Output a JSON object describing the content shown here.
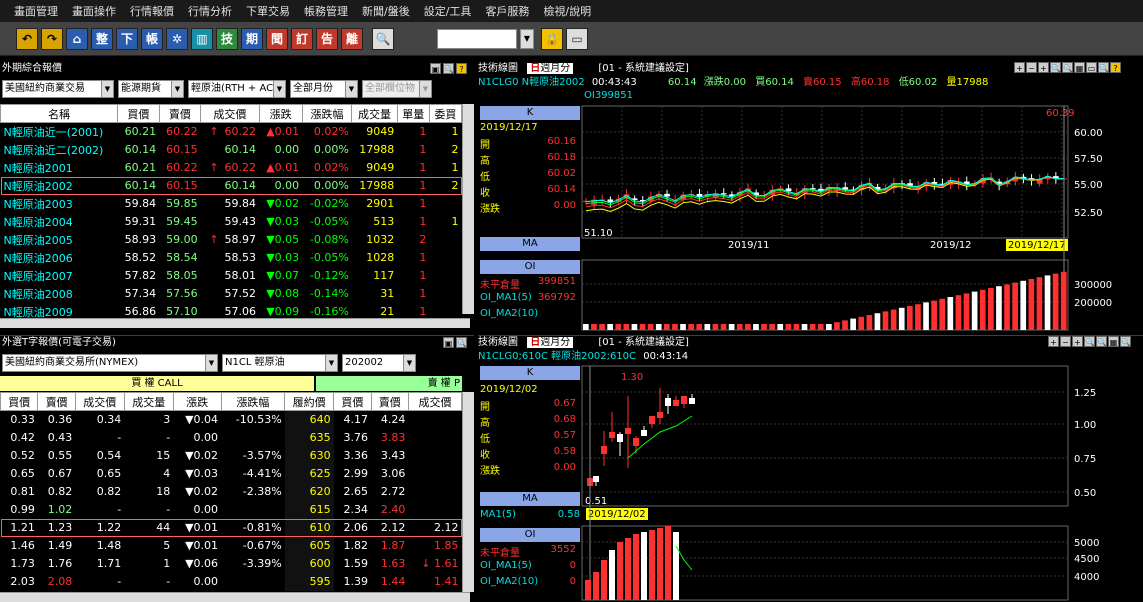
{
  "menu": [
    "畫面管理",
    "畫面操作",
    "行情報價",
    "行情分析",
    "下單交易",
    "帳務管理",
    "新聞/盤後",
    "設定/工具",
    "客戶服務",
    "檢視/說明"
  ],
  "toolbar": {
    "buttons": [
      "undo",
      "redo",
      "home",
      "整",
      "下",
      "帳",
      "gear",
      "chart",
      "技",
      "期",
      "聞",
      "訂",
      "告",
      "離",
      "search"
    ]
  },
  "futures": {
    "title": "外期綜合報價",
    "filters": [
      "美國紐約商業交易",
      "能源期貨",
      "輕原油(RTH + ACC",
      "全部月份",
      "全部欄位物"
    ],
    "headers": [
      "名稱",
      "買價",
      "賣價",
      "成交價",
      "漲跌",
      "漲跌幅",
      "成交量",
      "單量",
      "委買"
    ],
    "rows": [
      {
        "name": "N輕原油近一(2001)",
        "bid": "60.21",
        "ask": "60.22",
        "arrow": "↑",
        "last": "60.22",
        "chg": "▲0.01",
        "pct": "0.02%",
        "vol": "9049",
        "unit": "1",
        "x": "1",
        "c": "up"
      },
      {
        "name": "N輕原油近二(2002)",
        "bid": "60.14",
        "ask": "60.15",
        "arrow": "",
        "last": "60.14",
        "chg": "0.00",
        "pct": "0.00%",
        "vol": "17988",
        "unit": "1",
        "x": "2",
        "c": "wh"
      },
      {
        "name": "N輕原油2001",
        "bid": "60.21",
        "ask": "60.22",
        "arrow": "↑",
        "last": "60.22",
        "chg": "▲0.01",
        "pct": "0.02%",
        "vol": "9049",
        "unit": "1",
        "x": "1",
        "c": "up"
      },
      {
        "name": "N輕原油2002",
        "bid": "60.14",
        "ask": "60.15",
        "arrow": "",
        "last": "60.14",
        "chg": "0.00",
        "pct": "0.00%",
        "vol": "17988",
        "unit": "1",
        "x": "2",
        "c": "wh"
      },
      {
        "name": "N輕原油2003",
        "bid": "59.84",
        "ask": "59.85",
        "arrow": "",
        "last": "59.84",
        "chg": "▼0.02",
        "pct": "-0.02%",
        "vol": "2901",
        "unit": "1",
        "x": "",
        "c": "dn"
      },
      {
        "name": "N輕原油2004",
        "bid": "59.31",
        "ask": "59.45",
        "arrow": "",
        "last": "59.43",
        "chg": "▼0.03",
        "pct": "-0.05%",
        "vol": "513",
        "unit": "1",
        "x": "1",
        "c": "dn"
      },
      {
        "name": "N輕原油2005",
        "bid": "58.93",
        "ask": "59.00",
        "arrow": "↑",
        "last": "58.97",
        "chg": "▼0.05",
        "pct": "-0.08%",
        "vol": "1032",
        "unit": "2",
        "x": "",
        "c": "dn"
      },
      {
        "name": "N輕原油2006",
        "bid": "58.52",
        "ask": "58.54",
        "arrow": "",
        "last": "58.53",
        "chg": "▼0.03",
        "pct": "-0.05%",
        "vol": "1028",
        "unit": "1",
        "x": "",
        "c": "dn"
      },
      {
        "name": "N輕原油2007",
        "bid": "57.82",
        "ask": "58.05",
        "arrow": "",
        "last": "58.01",
        "chg": "▼0.07",
        "pct": "-0.12%",
        "vol": "117",
        "unit": "1",
        "x": "",
        "c": "dn"
      },
      {
        "name": "N輕原油2008",
        "bid": "57.34",
        "ask": "57.56",
        "arrow": "",
        "last": "57.52",
        "chg": "▼0.08",
        "pct": "-0.14%",
        "vol": "31",
        "unit": "1",
        "x": "",
        "c": "dn"
      },
      {
        "name": "N輕原油2009",
        "bid": "56.86",
        "ask": "57.10",
        "arrow": "",
        "last": "57.06",
        "chg": "▼0.09",
        "pct": "-0.16%",
        "vol": "21",
        "unit": "1",
        "x": "",
        "c": "dn"
      }
    ]
  },
  "options": {
    "title": "外選T字報價(可電子交易)",
    "exchange": "美國紐約商業交易所(NYMEX)",
    "product": "N1CL 輕原油",
    "month": "202002",
    "call_label": "買 權 CALL",
    "put_label": "賣 權 P",
    "headers": [
      "買價",
      "賣價",
      "成交價",
      "成交量",
      "漲跌",
      "漲跌幅",
      "履約價",
      "買價",
      "賣價",
      "成交價"
    ],
    "rows": [
      {
        "cb": "0.33",
        "ca": "0.36",
        "cl": "0.34",
        "cv": "3",
        "ch": "▼0.04",
        "cp": "-10.53%",
        "k": "640",
        "pb": "4.17",
        "pa": "4.24",
        "pl": "",
        "pc": "wh"
      },
      {
        "cb": "0.42",
        "ca": "0.43",
        "cl": "-",
        "cv": "-",
        "ch": "0.00",
        "cp": "",
        "k": "635",
        "pb": "3.76",
        "pa": "3.83",
        "pl": "",
        "pc": "up"
      },
      {
        "cb": "0.52",
        "ca": "0.55",
        "cl": "0.54",
        "cv": "15",
        "ch": "▼0.02",
        "cp": "-3.57%",
        "k": "630",
        "pb": "3.36",
        "pa": "3.43",
        "pl": "",
        "pc": "wh"
      },
      {
        "cb": "0.65",
        "ca": "0.67",
        "cl": "0.65",
        "cv": "4",
        "ch": "▼0.03",
        "cp": "-4.41%",
        "k": "625",
        "pb": "2.99",
        "pa": "3.06",
        "pl": "",
        "pc": "wh"
      },
      {
        "cb": "0.81",
        "ca": "0.82",
        "cl": "0.82",
        "cv": "18",
        "ch": "▼0.02",
        "cp": "-2.38%",
        "k": "620",
        "pb": "2.65",
        "pa": "2.72",
        "pl": "",
        "pc": "wh"
      },
      {
        "cb": "0.99",
        "ca": "1.02",
        "cl": "-",
        "cv": "-",
        "ch": "0.00",
        "cp": "",
        "k": "615",
        "pb": "2.34",
        "pa": "2.40",
        "pl": "",
        "pc": "up"
      },
      {
        "cb": "1.21",
        "ca": "1.23",
        "cl": "1.22",
        "cv": "44",
        "ch": "▼0.01",
        "cp": "-0.81%",
        "k": "610",
        "pb": "2.06",
        "pa": "2.12",
        "pl": "2.12",
        "pc": "wh"
      },
      {
        "cb": "1.46",
        "ca": "1.49",
        "cl": "1.48",
        "cv": "5",
        "ch": "▼0.01",
        "cp": "-0.67%",
        "k": "605",
        "pb": "1.82",
        "pa": "1.87",
        "pl": "1.85",
        "pc": "up"
      },
      {
        "cb": "1.73",
        "ca": "1.76",
        "cl": "1.71",
        "cv": "1",
        "ch": "▼0.06",
        "cp": "-3.39%",
        "k": "600",
        "pb": "1.59",
        "pa": "1.63",
        "pl": "↓ 1.61",
        "pc": "up"
      },
      {
        "cb": "2.03",
        "ca": "2.08",
        "cl": "-",
        "cv": "-",
        "ch": "0.00",
        "cp": "",
        "k": "595",
        "pb": "1.39",
        "pa": "1.44",
        "pl": "1.41",
        "pc": "up"
      }
    ]
  },
  "chart1": {
    "title": "技術線圖",
    "period_tabs": [
      "日",
      "週",
      "月",
      "分"
    ],
    "setting": "[01 - 系統建議設定]",
    "symbol": "N1CLG0 N輕原油2002",
    "time": "00:43:43",
    "last": "60.14",
    "change": "漲跌0.00",
    "bid": "買60.14",
    "ask": "賣60.15",
    "high": "高60.18",
    "low": "低60.02",
    "volume": "量17988",
    "oi": "OI399851",
    "k_label": "K",
    "date": "2019/12/17",
    "ohlc": [
      {
        "l": "開",
        "v": "60.16"
      },
      {
        "l": "高",
        "v": "60.18"
      },
      {
        "l": "低",
        "v": "60.02"
      },
      {
        "l": "收",
        "v": "60.14"
      },
      {
        "l": "漲跌",
        "v": "0.00"
      }
    ],
    "ma_label": "MA",
    "oi_label": "OI",
    "oi_rows": [
      {
        "l": "未平倉量",
        "v": "399851"
      },
      {
        "l": "OI_MA1(5)",
        "v": "369792"
      },
      {
        "l": "OI_MA2(10)",
        "v": ""
      }
    ],
    "high_marker": "60.39",
    "low_marker": "51.10",
    "y_ticks": [
      "60.00",
      "57.50",
      "55.00",
      "52.50"
    ],
    "x_ticks": [
      "2019/11",
      "2019/12"
    ],
    "cursor_date": "2019/12/17",
    "oi_ticks": [
      "300000",
      "200000"
    ]
  },
  "chart2": {
    "title": "技術線圖",
    "period_tabs": [
      "日",
      "週",
      "月",
      "分"
    ],
    "setting": "[01 - 系統建議設定]",
    "symbol": "N1CLG0;610C 輕原油2002;610C",
    "time": "00:43:14",
    "k_label": "K",
    "date": "2019/12/02",
    "ohlc": [
      {
        "l": "開",
        "v": "0.67"
      },
      {
        "l": "高",
        "v": "0.68"
      },
      {
        "l": "低",
        "v": "0.57"
      },
      {
        "l": "收",
        "v": "0.58"
      },
      {
        "l": "漲跌",
        "v": "0.00"
      }
    ],
    "ma_label": "MA",
    "ma1": {
      "l": "MA1(5)",
      "v": "0.58"
    },
    "oi_label": "OI",
    "oi_rows": [
      {
        "l": "未平倉量",
        "v": "3552"
      },
      {
        "l": "OI_MA1(5)",
        "v": "0"
      },
      {
        "l": "OI_MA2(10)",
        "v": "0"
      }
    ],
    "high_marker": "1.30",
    "low_marker": "0.51",
    "y_ticks": [
      "1.25",
      "1.00",
      "0.75",
      "0.50"
    ],
    "cursor_date": "2019/12/02",
    "oi_ticks": [
      "5000",
      "4500",
      "4000"
    ]
  }
}
